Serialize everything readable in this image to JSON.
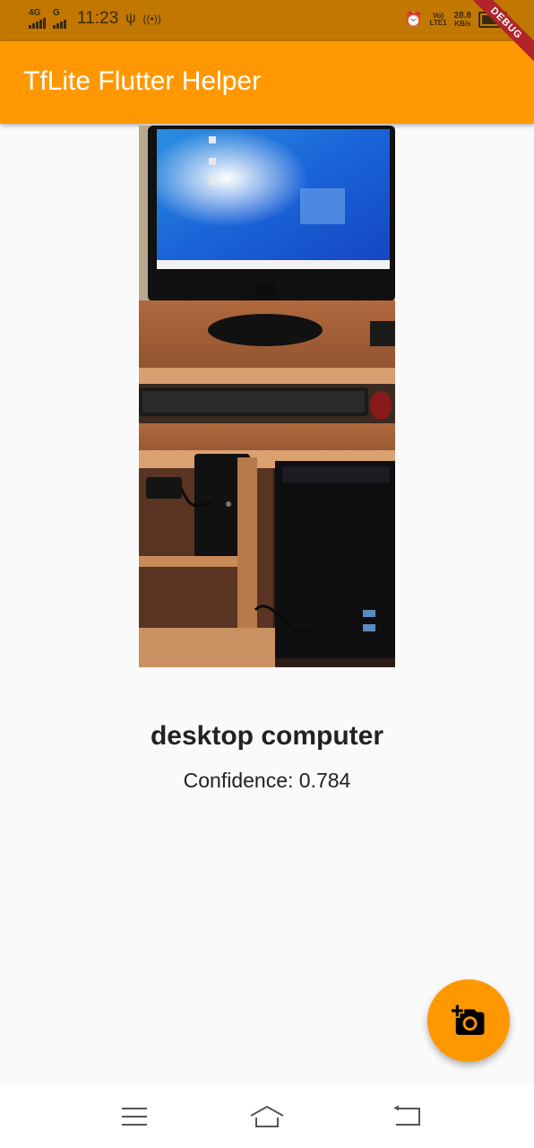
{
  "status_bar": {
    "network_left": "4G",
    "network_right": "G",
    "time": "11:23",
    "volte": "Vo)",
    "lte": "LTE1",
    "speed_value": "28.8",
    "speed_unit": "KB/s",
    "battery_level": 0.8
  },
  "debug_banner": "DEBUG",
  "app_bar": {
    "title": "TfLite Flutter Helper"
  },
  "result": {
    "label": "desktop computer",
    "confidence_text": "Confidence: 0.784"
  },
  "fab": {
    "icon": "add-a-photo-icon"
  },
  "nav_bar": {
    "icons": [
      "menu-icon",
      "home-icon",
      "back-icon"
    ]
  },
  "colors": {
    "primary": "#ff9800",
    "status_bar": "#c27700",
    "debug": "#b0242a"
  }
}
